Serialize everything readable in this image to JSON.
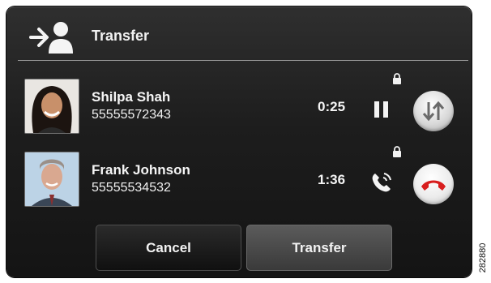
{
  "header": {
    "title": "Transfer",
    "icon": "transfer-icon"
  },
  "calls": [
    {
      "name": "Shilpa Shah",
      "number": "55555572343",
      "timer": "0:25",
      "status_icon": "hold-icon",
      "action": "swap-calls-icon"
    },
    {
      "name": "Frank Johnson",
      "number": "55555534532",
      "timer": "1:36",
      "status_icon": "active-call-icon",
      "action": "end-call-icon"
    }
  ],
  "buttons": {
    "cancel": "Cancel",
    "transfer": "Transfer"
  },
  "side_id": "282880",
  "colors": {
    "end_call_red": "#d81e1e",
    "background": "#1d1d1d",
    "text": "#f5f5f5"
  }
}
